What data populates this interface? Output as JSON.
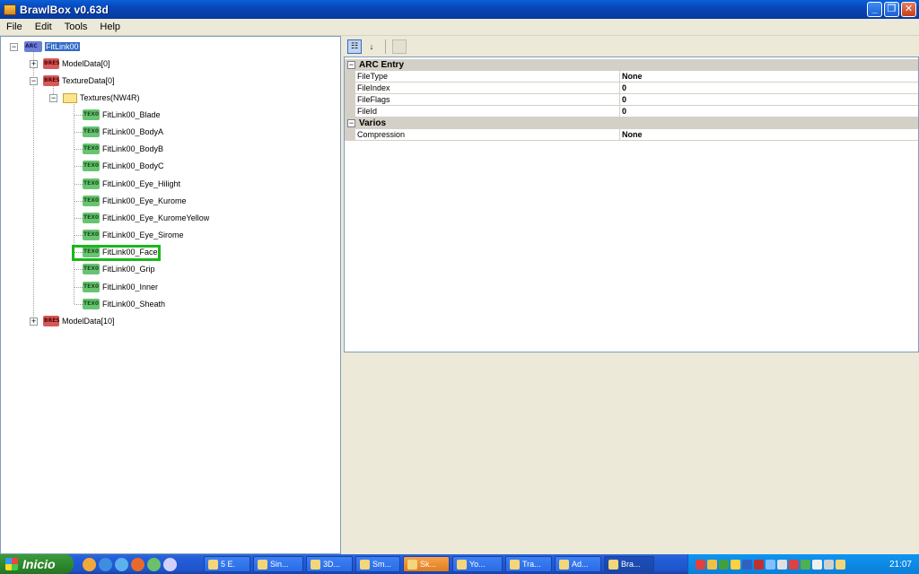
{
  "window": {
    "title": "BrawlBox v0.63d"
  },
  "menu": [
    "File",
    "Edit",
    "Tools",
    "Help"
  ],
  "tree": {
    "root": {
      "type": "ARC",
      "label": "FitLink00"
    },
    "modeldata0": {
      "type": "BRES",
      "label": "ModelData[0]"
    },
    "texturedata0": {
      "type": "BRES",
      "label": "TextureData[0]"
    },
    "textures_folder": {
      "label": "Textures(NW4R)"
    },
    "textures": [
      "FitLink00_Blade",
      "FitLink00_BodyA",
      "FitLink00_BodyB",
      "FitLink00_BodyC",
      "FitLink00_Eye_Hilight",
      "FitLink00_Eye_Kurome",
      "FitLink00_Eye_KuromeYellow",
      "FitLink00_Eye_Sirome",
      "FitLink00_Face",
      "FitLink00_Grip",
      "FitLink00_Inner",
      "FitLink00_Sheath"
    ],
    "texture_type": "TEX0",
    "modeldata10": {
      "type": "BRES",
      "label": "ModelData[10]"
    }
  },
  "properties": {
    "categories": [
      {
        "name": "ARC Entry",
        "rows": [
          {
            "name": "FileType",
            "value": "None"
          },
          {
            "name": "FileIndex",
            "value": "0"
          },
          {
            "name": "FileFlags",
            "value": "0"
          },
          {
            "name": "FileId",
            "value": "0"
          }
        ]
      },
      {
        "name": "Varios",
        "rows": [
          {
            "name": "Compression",
            "value": "None"
          }
        ]
      }
    ]
  },
  "taskbar": {
    "start_label": "Inicio",
    "tasks": [
      "5 E.",
      "Sin...",
      "3D...",
      "Sm...",
      "Sk...",
      "Yo...",
      "Tra...",
      "Ad...",
      "Bra..."
    ],
    "clock": "21:07"
  },
  "colors": {
    "selection": "#316ac5",
    "highlight_box": "#1ab81a",
    "titlebar": "#0a5fd8"
  }
}
